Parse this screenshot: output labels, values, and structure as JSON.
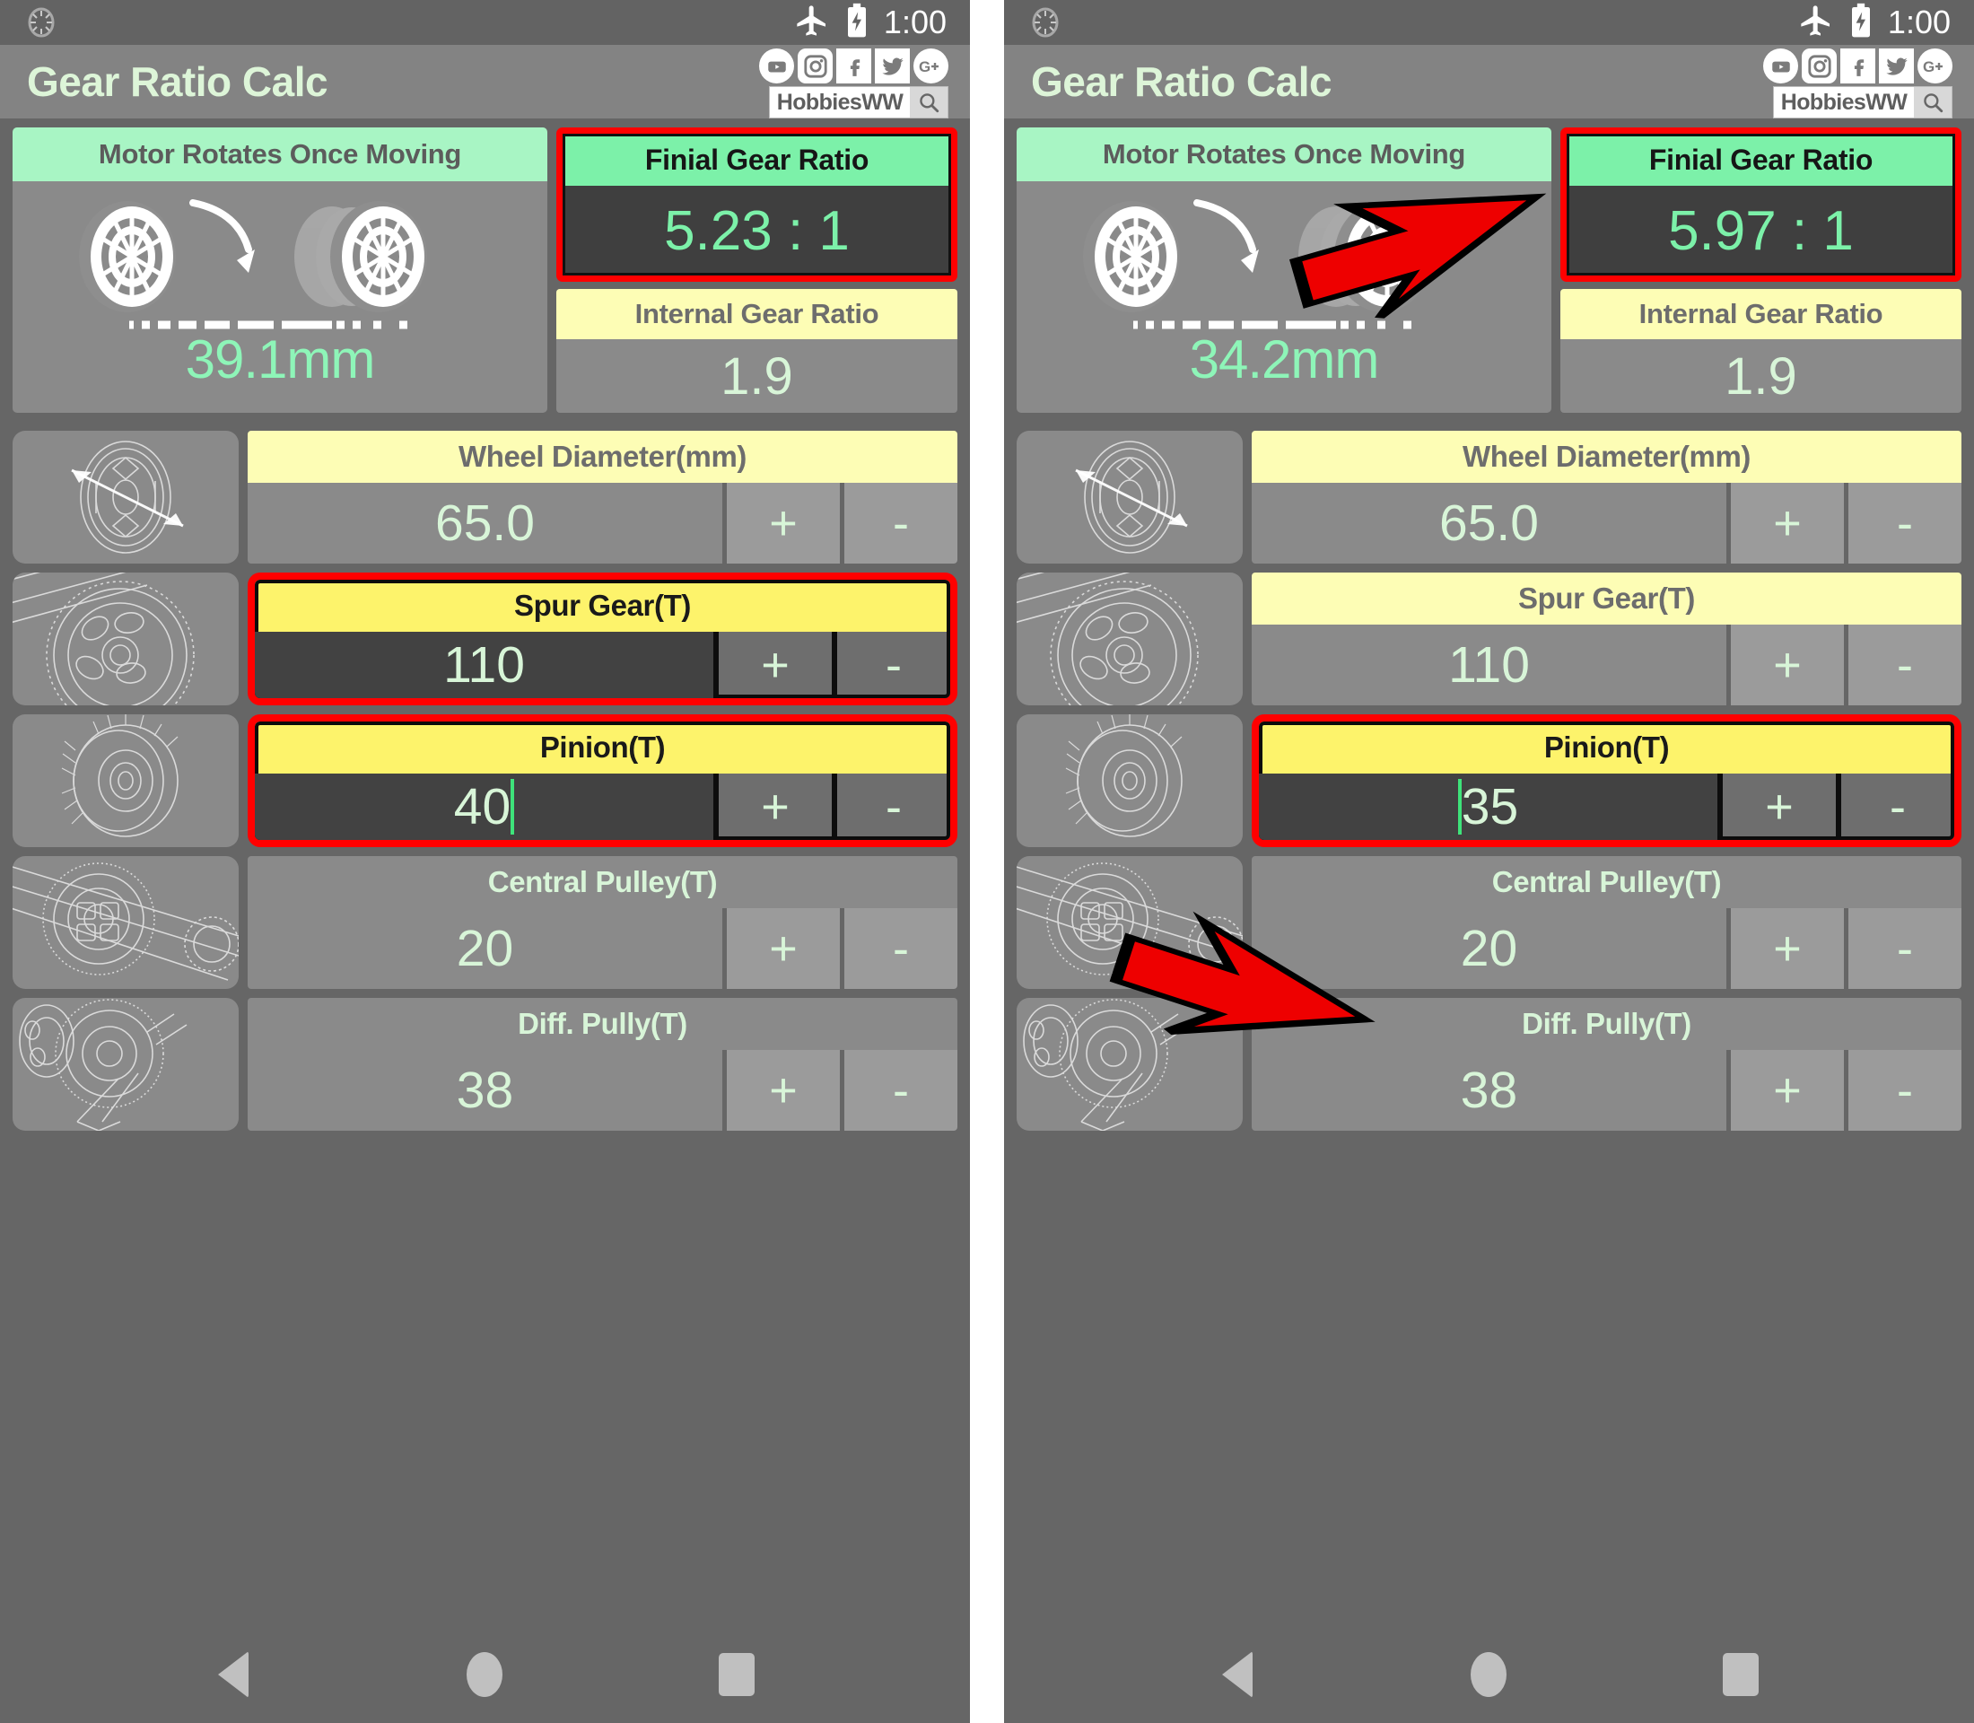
{
  "colors": {
    "accent_green": "#8ef5b8",
    "header_green": "#7cf1a9",
    "label_yellow": "#fdfdb5",
    "label_yellow_focus": "#fdf36b",
    "highlight_red": "#ff0000",
    "background": "#666666",
    "appbar": "#838383",
    "card": "#8a8a8a",
    "input_focus": "#424242"
  },
  "statusbar": {
    "airplane_icon": "airplane-icon",
    "battery_icon": "battery-charging-icon",
    "time": "1:00"
  },
  "appbar": {
    "title": "Gear Ratio Calc",
    "social": [
      {
        "name": "youtube-icon",
        "label": "YouTube"
      },
      {
        "name": "instagram-icon",
        "label": "Instagram"
      },
      {
        "name": "facebook-icon",
        "label": "Facebook"
      },
      {
        "name": "twitter-icon",
        "label": "Twitter"
      },
      {
        "name": "googleplus-icon",
        "label": "Google Plus"
      }
    ],
    "search_brand": "HobbiesWW",
    "search_icon": "search-icon"
  },
  "navbar": {
    "back": "back-button",
    "home": "home-button",
    "recents": "recents-button"
  },
  "panels": [
    {
      "id": "before",
      "motor": {
        "header": "Motor Rotates Once Moving",
        "distance": "39.1mm"
      },
      "final_ratio": {
        "header": "Finial Gear Ratio",
        "value": "5.23 : 1",
        "highlighted": true
      },
      "internal_ratio": {
        "header": "Internal Gear Ratio",
        "value": "1.9"
      },
      "fields": [
        {
          "label": "Wheel Diameter(mm)",
          "value": "65.0",
          "plus": "+",
          "minus": "-",
          "label_style": "yellow",
          "focused": false,
          "highlighted": false,
          "caret": "none",
          "thumb": "wheel-diameter-icon"
        },
        {
          "label": "Spur Gear(T)",
          "value": "110",
          "plus": "+",
          "minus": "-",
          "label_style": "yellow",
          "focused": true,
          "highlighted": true,
          "caret": "none",
          "thumb": "spur-gear-icon"
        },
        {
          "label": "Pinion(T)",
          "value": "40",
          "plus": "+",
          "minus": "-",
          "label_style": "yellow",
          "focused": true,
          "highlighted": true,
          "caret": "after",
          "thumb": "pinion-gear-icon"
        },
        {
          "label": "Central Pulley(T)",
          "value": "20",
          "plus": "+",
          "minus": "-",
          "label_style": "plain",
          "focused": false,
          "highlighted": false,
          "caret": "none",
          "thumb": "central-pulley-icon"
        },
        {
          "label": "Diff. Pully(T)",
          "value": "38",
          "plus": "+",
          "minus": "-",
          "label_style": "plain",
          "focused": false,
          "highlighted": false,
          "caret": "none",
          "thumb": "diff-pulley-icon"
        }
      ],
      "arrows": []
    },
    {
      "id": "after",
      "motor": {
        "header": "Motor Rotates Once Moving",
        "distance": "34.2mm"
      },
      "final_ratio": {
        "header": "Finial Gear Ratio",
        "value": "5.97 : 1",
        "highlighted": true
      },
      "internal_ratio": {
        "header": "Internal Gear Ratio",
        "value": "1.9"
      },
      "fields": [
        {
          "label": "Wheel Diameter(mm)",
          "value": "65.0",
          "plus": "+",
          "minus": "-",
          "label_style": "yellow",
          "focused": false,
          "highlighted": false,
          "caret": "none",
          "thumb": "wheel-diameter-icon"
        },
        {
          "label": "Spur Gear(T)",
          "value": "110",
          "plus": "+",
          "minus": "-",
          "label_style": "yellow",
          "focused": false,
          "highlighted": false,
          "caret": "none",
          "thumb": "spur-gear-icon"
        },
        {
          "label": "Pinion(T)",
          "value": "35",
          "plus": "+",
          "minus": "-",
          "label_style": "yellow",
          "focused": true,
          "highlighted": true,
          "caret": "before",
          "thumb": "pinion-gear-icon"
        },
        {
          "label": "Central Pulley(T)",
          "value": "20",
          "plus": "+",
          "minus": "-",
          "label_style": "plain",
          "focused": false,
          "highlighted": false,
          "caret": "none",
          "thumb": "central-pulley-icon"
        },
        {
          "label": "Diff. Pully(T)",
          "value": "38",
          "plus": "+",
          "minus": "-",
          "label_style": "plain",
          "focused": false,
          "highlighted": false,
          "caret": "none",
          "thumb": "diff-pulley-icon"
        }
      ],
      "arrows": [
        {
          "name": "annotation-arrow-final-ratio",
          "target": "final_ratio"
        },
        {
          "name": "annotation-arrow-pinion",
          "target": "pinion"
        }
      ]
    }
  ]
}
